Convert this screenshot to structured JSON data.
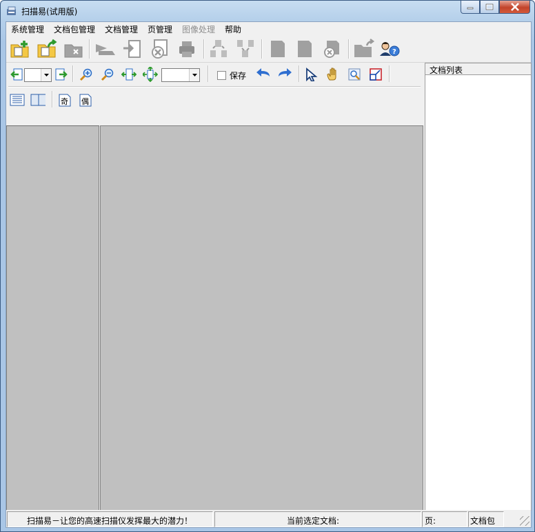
{
  "window": {
    "title": "扫描易(试用版)"
  },
  "menu": [
    {
      "label": "系统管理",
      "disabled": false
    },
    {
      "label": "文档包管理",
      "disabled": false
    },
    {
      "label": "文档管理",
      "disabled": false
    },
    {
      "label": "页管理",
      "disabled": false
    },
    {
      "label": "图像处理",
      "disabled": true
    },
    {
      "label": "帮助",
      "disabled": false
    }
  ],
  "toolbar": {
    "icons": [
      "new-package-icon",
      "open-package-icon",
      "close-package-icon",
      "scan-icon",
      "import-icon",
      "delete-doc-icon",
      "print-icon",
      "move-up-icon",
      "move-down-icon",
      "page-1-icon",
      "page-2-icon",
      "delete-page-icon",
      "export-icon",
      "help-user-icon"
    ]
  },
  "viewbar": {
    "save_label": "保存",
    "page_combo_value": "",
    "zoom_combo_value": "",
    "odd_label": "奇",
    "even_label": "偶"
  },
  "right_panel": {
    "header": "文档列表"
  },
  "status": {
    "slogan": "扫描易－让您的高速扫描仪发挥最大的潜力！",
    "current_doc_label": "当前选定文档:",
    "page_label": "页:",
    "package_label": "文档包"
  }
}
